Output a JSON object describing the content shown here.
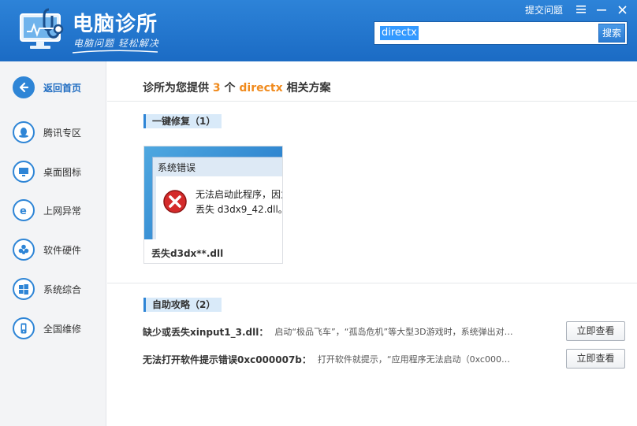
{
  "app": {
    "title": "电脑诊所",
    "subtitle": "电脑问题 轻松解决"
  },
  "top_bar": {
    "feedback_label": "提交问题",
    "menu_icon": "menu-icon",
    "minimize_icon": "minimize-icon",
    "close_icon": "close-icon"
  },
  "search": {
    "value": "directx",
    "button_label": "搜索"
  },
  "sidebar": {
    "items": [
      {
        "label": "返回首页",
        "icon": "back-arrow-icon",
        "active": true
      },
      {
        "label": "腾讯专区",
        "icon": "qq-penguin-icon"
      },
      {
        "label": "桌面图标",
        "icon": "monitor-icon"
      },
      {
        "label": "上网异常",
        "icon": "ie-browser-icon"
      },
      {
        "label": "软件硬件",
        "icon": "puzzle-icon"
      },
      {
        "label": "系统综合",
        "icon": "windows-icon"
      },
      {
        "label": "全国维修",
        "icon": "phone-icon"
      }
    ]
  },
  "results": {
    "prefix": "诊所为您提供",
    "count": "3",
    "middle": "个",
    "keyword": "directx",
    "suffix": "相关方案"
  },
  "quick_fix": {
    "section_label": "一键修复（1）",
    "cards": [
      {
        "dialog_title": "系统错误",
        "dialog_line1": "无法启动此程序，因为",
        "dialog_line2": "丢失 d3dx9_42.dll。",
        "caption": "丢失d3dx**.dll"
      }
    ]
  },
  "guides": {
    "section_label": "自助攻略（2）",
    "items": [
      {
        "title": "缺少或丢失xinput1_3.dll：",
        "desc": "启动“极品飞车”，“孤岛危机”等大型3D游戏时，系统弹出对…",
        "button_label": "立即查看"
      },
      {
        "title": "无法打开软件提示错误0xc000007b：",
        "desc": "打开软件就提示，“应用程序无法启动（0xc000…",
        "button_label": "立即查看"
      }
    ]
  },
  "colors": {
    "header_blue": "#2d83d8",
    "accent_orange": "#f08a1c",
    "sidebar_bg": "#f3f4f6",
    "tag_bg": "#d9eaf9"
  }
}
